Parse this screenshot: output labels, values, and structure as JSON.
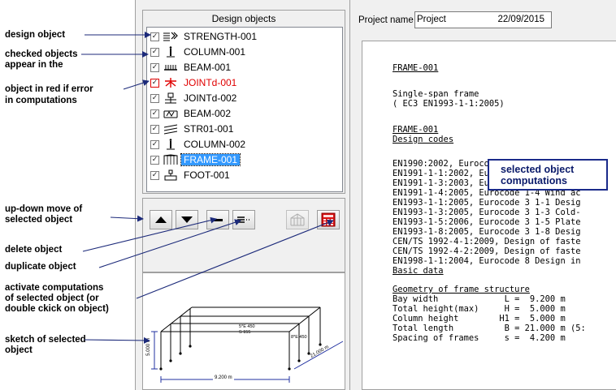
{
  "annotations": {
    "design_object": "design object",
    "checked_1": "checked objects",
    "checked_2": "appear in the",
    "error_1": "object in red if error",
    "error_2": "in computations",
    "updown_1": "up-down move of",
    "updown_2": "selected object",
    "delete": "delete object",
    "duplicate": "duplicate object",
    "activate_1": "activate computations",
    "activate_2": "of selected object (or",
    "activate_3": "double ckick on object)",
    "sketch_1": "sketch of selected",
    "sketch_2": "object"
  },
  "design_objects": {
    "title": "Design objects",
    "items": [
      {
        "label": "STRENGTH-001",
        "icon": "strength-icon",
        "checked": true
      },
      {
        "label": "COLUMN-001",
        "icon": "column-icon",
        "checked": true
      },
      {
        "label": "BEAM-001",
        "icon": "beam-icon",
        "checked": true
      },
      {
        "label": "JOINTd-001",
        "icon": "joint-icon",
        "checked": true,
        "error": true
      },
      {
        "label": "JOINTd-002",
        "icon": "joint-icon",
        "checked": true
      },
      {
        "label": "BEAM-002",
        "icon": "beam-icon",
        "checked": true
      },
      {
        "label": "STR01-001",
        "icon": "structure-icon",
        "checked": true
      },
      {
        "label": "COLUMN-002",
        "icon": "column-icon",
        "checked": true
      },
      {
        "label": "FRAME-001",
        "icon": "frame-icon",
        "checked": true,
        "selected": true
      },
      {
        "label": "FOOT-001",
        "icon": "foot-icon",
        "checked": true
      }
    ]
  },
  "toolbar": {
    "move_up": "move-up-icon",
    "move_down": "move-down-icon",
    "delete": "delete-icon",
    "duplicate": "duplicate-icon",
    "sketch_toggle": "frame-sketch-icon",
    "compute": "calculator-icon"
  },
  "sketch": {
    "width_label": "9.200 m",
    "length_label": "21.000 m",
    "height_label": "5.000 m",
    "dim_a": "5*E 450",
    "dim_b": "S 155",
    "dim_c": "8*E 450"
  },
  "project": {
    "label": "Project name",
    "name": "Project",
    "date": "22/09/2015"
  },
  "callout": {
    "line1": "selected object",
    "line2": "computations"
  },
  "report": {
    "title": "FRAME-001",
    "subtitle": "Single-span frame",
    "standard": "( EC3 EN1993-1-1:2005)",
    "design_codes_title": "FRAME-001",
    "design_codes_heading": "Design codes",
    "codes": [
      "EN1990:2002, Eurocode 0 Basis of Struc",
      "EN1991-1-1:2002, Eurocode 1-1 Actions",
      "EN1991-1-3:2003, Eurocode 1-3 Snow lo",
      "EN1991-1-4:2005, Eurocode 1-4 Wind ac",
      "EN1993-1-1:2005, Eurocode 3 1-1 Desig",
      "EN1993-1-3:2005, Eurocode 3 1-3 Cold-",
      "EN1993-1-5:2006, Eurocode 3 1-5 Plate",
      "EN1993-1-8:2005, Eurocode 3 1-8 Desig",
      "CEN/TS 1992-4-1:2009, Design of faste",
      "CEN/TS 1992-4-2:2009, Design of faste",
      "EN1998-1-1:2004, Eurocode 8 Design in"
    ],
    "basic_data": "Basic data",
    "geometry_heading": "Geometry of frame structure",
    "geometry": [
      "Bay width             L =  9.200 m",
      "Total height(max)     H =  5.000 m",
      "Column height        H1 =  5.000 m",
      "Total length          B = 21.000 m (5:",
      "Spacing of frames     s =  4.200 m"
    ]
  }
}
